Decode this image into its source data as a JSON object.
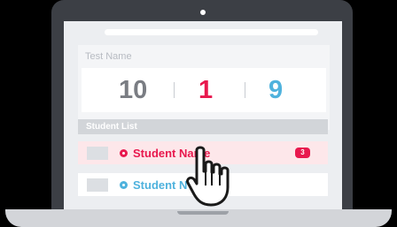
{
  "stats": {
    "test_name": "Test Name",
    "total": "10",
    "red_count": "1",
    "blue_count": "9",
    "divider": "|"
  },
  "student_list": {
    "header": "Student List",
    "rows": [
      {
        "name": "Student Name",
        "badge": "3",
        "status": "red"
      },
      {
        "name": "Student N",
        "badge": "",
        "status": "blue"
      }
    ]
  },
  "colors": {
    "accent_red": "#e8194e",
    "accent_blue": "#4fb2dd",
    "frame": "#3c3f45"
  },
  "icons": {
    "cursor": "hand-pointer-icon",
    "camera": "camera-dot",
    "status": "alert-dot-icon"
  }
}
